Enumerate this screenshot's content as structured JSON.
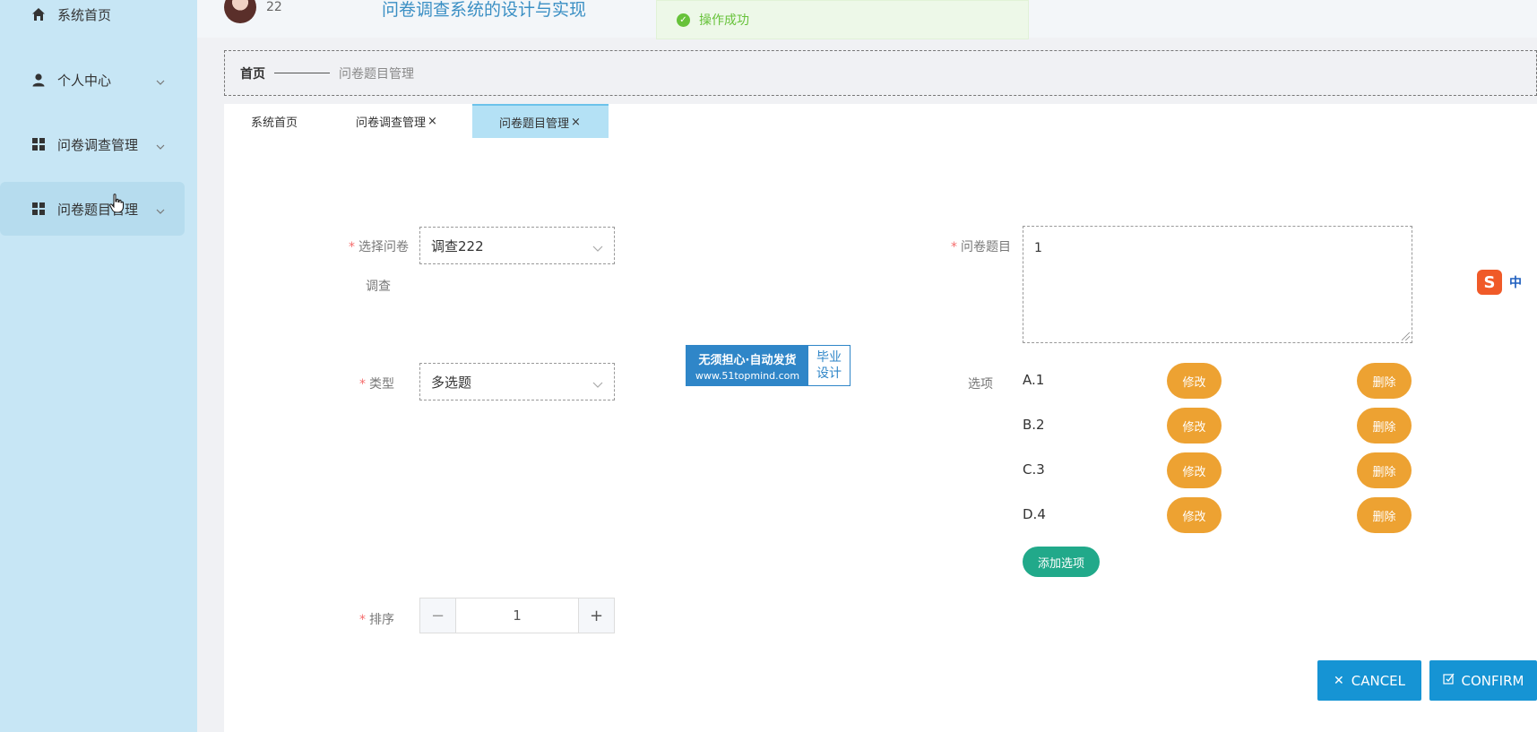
{
  "sidebar": {
    "items": [
      {
        "label": "系统首页",
        "icon": "home-icon"
      },
      {
        "label": "个人中心",
        "icon": "user-icon"
      },
      {
        "label": "问卷调查管理",
        "icon": "grid-icon"
      },
      {
        "label": "问卷题目管理",
        "icon": "grid-icon"
      }
    ]
  },
  "header": {
    "user_name": "22",
    "system_title": "问卷调查系统的设计与实现",
    "toast": "操作成功"
  },
  "breadcrumb": {
    "home": "首页",
    "current": "问卷题目管理"
  },
  "tabs": [
    {
      "label": "系统首页",
      "close": ""
    },
    {
      "label": "问卷调查管理",
      "close": "×"
    },
    {
      "label": "问卷题目管理",
      "close": "×"
    }
  ],
  "form": {
    "survey_label": "选择问卷",
    "survey_label_line2": "调查",
    "survey_value": "调查222",
    "type_label": "类型",
    "type_value": "多选题",
    "sort_label": "排序",
    "sort_value": "1",
    "question_label": "问卷题目",
    "question_value": "1",
    "options_label": "选项",
    "options": [
      {
        "text": "A.1"
      },
      {
        "text": "B.2"
      },
      {
        "text": "C.3"
      },
      {
        "text": "D.4"
      }
    ],
    "edit_label": "修改",
    "delete_label": "删除",
    "add_option_label": "添加选项",
    "required_mark": "*"
  },
  "actions": {
    "cancel": "CANCEL",
    "confirm": "CONFIRM"
  },
  "watermark": {
    "line1": "无须担心·自动发货",
    "line2": "www.51topmind.com",
    "right1": "毕业",
    "right2": "设计"
  },
  "ime": {
    "logo": "S",
    "lang": "中"
  },
  "colors": {
    "sidebar_bg": "#c7e6f5",
    "active_tab": "#b4e1f5",
    "orange": "#eda232",
    "green": "#21a98a",
    "blue": "#1694d4",
    "success": "#67c23a"
  }
}
